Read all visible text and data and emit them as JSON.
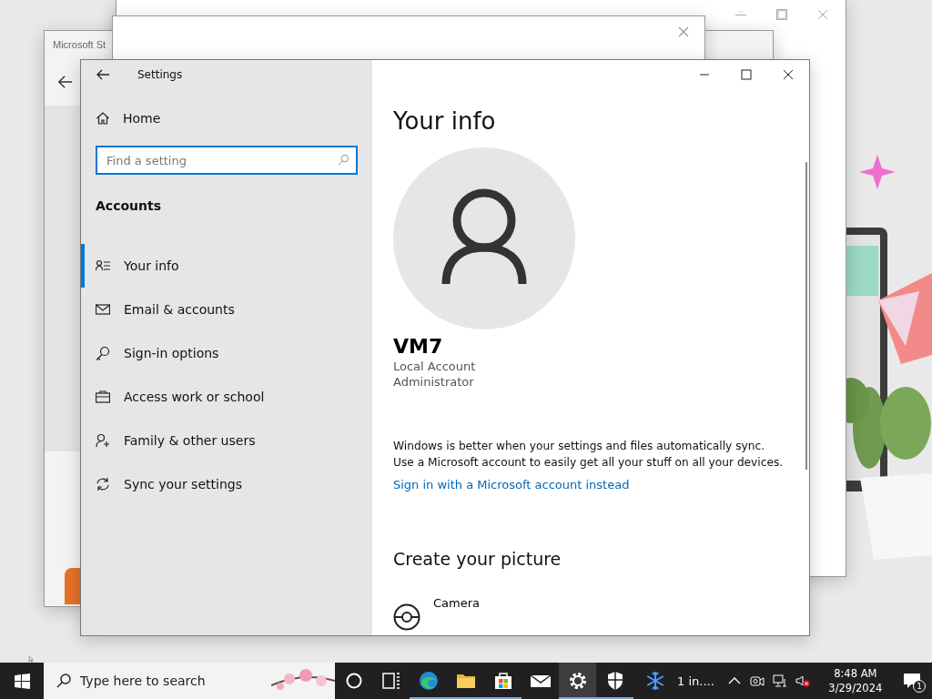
{
  "store_window": {
    "title": "Microsoft St"
  },
  "settings": {
    "title": "Settings",
    "home": "Home",
    "search": {
      "placeholder": "Find a setting"
    },
    "section": "Accounts",
    "nav": [
      {
        "label": "Your info",
        "kind": "info",
        "selected": true
      },
      {
        "label": "Email & accounts",
        "kind": "mail",
        "selected": false
      },
      {
        "label": "Sign-in options",
        "kind": "key",
        "selected": false
      },
      {
        "label": "Access work or school",
        "kind": "briefcase",
        "selected": false
      },
      {
        "label": "Family & other users",
        "kind": "person",
        "selected": false
      },
      {
        "label": "Sync your settings",
        "kind": "sync",
        "selected": false
      }
    ],
    "page": {
      "heading": "Your info",
      "name": "VM7",
      "account_type": "Local Account",
      "role": "Administrator",
      "sync_lines": [
        "Windows is better when your settings and files automatically sync.",
        "Use a Microsoft account to easily get all your stuff on all your devices."
      ],
      "link": "Sign in with a Microsoft account instead",
      "subheading": "Create your picture",
      "options": [
        {
          "label": "Camera",
          "kind": "camera"
        }
      ]
    }
  },
  "taskbar": {
    "search": {
      "placeholder": "Type here to search"
    },
    "apps": [
      {
        "kind": "cortana",
        "running": false,
        "selected": false
      },
      {
        "kind": "taskview",
        "running": false,
        "selected": false
      },
      {
        "kind": "browser",
        "running": true,
        "selected": false
      },
      {
        "kind": "folder",
        "running": true,
        "selected": false
      },
      {
        "kind": "store",
        "running": true,
        "selected": false
      },
      {
        "kind": "mail",
        "running": false,
        "selected": false
      },
      {
        "kind": "settings",
        "running": true,
        "selected": true
      },
      {
        "kind": "shield",
        "running": true,
        "selected": false
      }
    ],
    "weather": "1 in....",
    "time": "8:48 AM",
    "date": "3/29/2024",
    "notifications": "1"
  }
}
